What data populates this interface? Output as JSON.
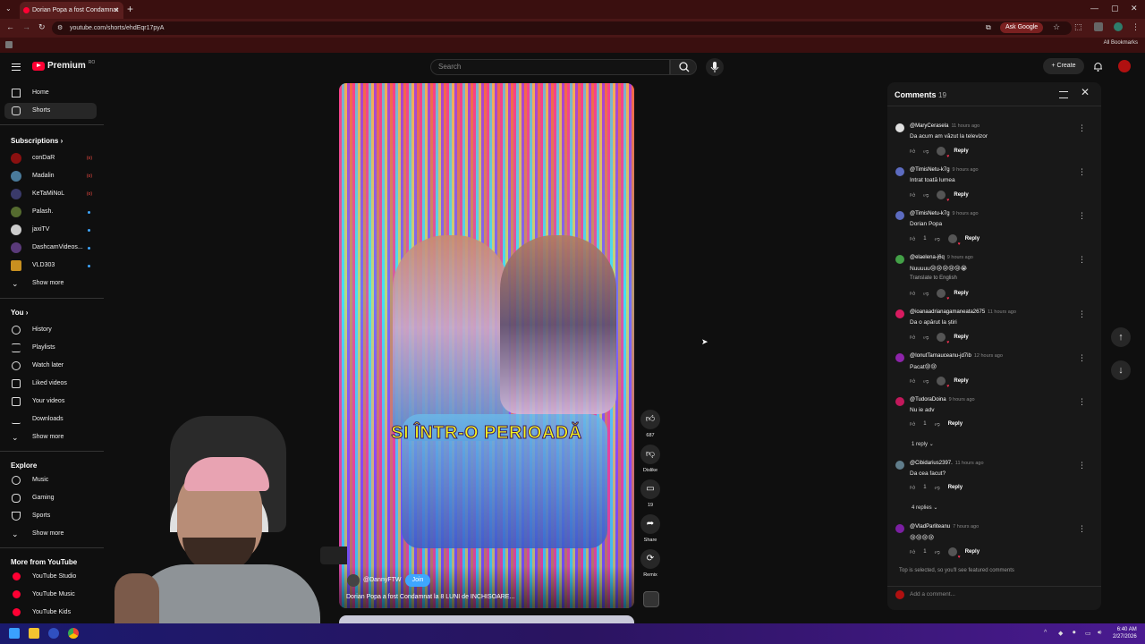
{
  "browser": {
    "tab_title": "Dorian Popa a fost Condamnat",
    "url": "youtube.com/shorts/ehdEqr17pyA",
    "ask_google": "Ask Google",
    "all_bookmarks": "All Bookmarks"
  },
  "header": {
    "logo_text": "Premium",
    "logo_country": "RO",
    "search_placeholder": "Search",
    "create_label": "Create"
  },
  "sidebar": {
    "home": "Home",
    "shorts": "Shorts",
    "subscriptions_title": "Subscriptions",
    "subscriptions": [
      {
        "name": "conDaR",
        "live": "(o)"
      },
      {
        "name": "Madalin",
        "live": "(o)"
      },
      {
        "name": "KeTaMiNoL",
        "live": "(o)"
      },
      {
        "name": "Palash.",
        "live": ""
      },
      {
        "name": "jaxiTV",
        "live": ""
      },
      {
        "name": "DashcamVideos...",
        "live": ""
      },
      {
        "name": "VLD303",
        "live": ""
      }
    ],
    "show_more": "Show more",
    "you_title": "You",
    "you_items": [
      "History",
      "Playlists",
      "Watch later",
      "Liked videos",
      "Your videos",
      "Downloads"
    ],
    "show_more_2": "Show more",
    "explore_title": "Explore",
    "explore_items": [
      "Music",
      "Gaming",
      "Sports"
    ],
    "show_more_3": "Show more",
    "more_title": "More from YouTube",
    "more_items": [
      "YouTube Studio",
      "YouTube Music",
      "YouTube Kids"
    ]
  },
  "video": {
    "caption": "SI ÎNTR-O PERIOADĂ",
    "channel": "@DannyFTW",
    "join_label": "Join",
    "title": "Dorian Popa a fost Condamnat la 8 LUNI de INCHISOARE..."
  },
  "actions": {
    "like_count": "687",
    "dislike_label": "Dislike",
    "comments_count": "19",
    "share_label": "Share",
    "remix_label": "Remix"
  },
  "comments": {
    "title": "Comments",
    "count": "19",
    "items": [
      {
        "user": "@MaryCerasela",
        "time": "11 hours ago",
        "text": "Da acum am văzut la televizor",
        "likes": "",
        "color": "#e0e0e0"
      },
      {
        "user": "@TimisNetu-k7g",
        "time": "9 hours ago",
        "text": "Intrat toată lumea",
        "likes": "",
        "color": "#5c6bc0"
      },
      {
        "user": "@TimisNetu-k7g",
        "time": "9 hours ago",
        "text": "Dorian Popa",
        "likes": "1",
        "color": "#5c6bc0"
      },
      {
        "user": "@elaelena-j6q",
        "time": "9 hours ago",
        "text": "Nuuuuu😢😢😢😢😢😭",
        "likes": "",
        "color": "#43a047",
        "translate": "Translate to English"
      },
      {
        "user": "@ioanaadrianagamaneata2675",
        "time": "11 hours ago",
        "text": "Da o apărut la știri",
        "likes": "",
        "color": "#d81b60"
      },
      {
        "user": "@IonutTarnauceanu-jd7ib",
        "time": "12 hours ago",
        "text": "Pacat😢😢",
        "likes": "",
        "color": "#8e24aa"
      },
      {
        "user": "@TudoraDoina",
        "time": "9 hours ago",
        "text": "Nu ie adv",
        "likes": "1",
        "color": "#c2185b",
        "replies": "1 reply"
      },
      {
        "user": "@Cibidarius2397.",
        "time": "11 hours ago",
        "text": "Da cea facut?",
        "likes": "1",
        "color": "#607d8b",
        "replies": "4 replies"
      },
      {
        "user": "@VladParliteanu",
        "time": "7 hours ago",
        "text": "😢😢😢😢",
        "likes": "1",
        "color": "#7b1fa2"
      }
    ],
    "reply_label": "Reply",
    "footer": "Top is selected, so you'll see featured comments",
    "add_placeholder": "Add a comment..."
  },
  "taskbar": {
    "time": "6:40 AM",
    "date": "2/27/2026"
  }
}
